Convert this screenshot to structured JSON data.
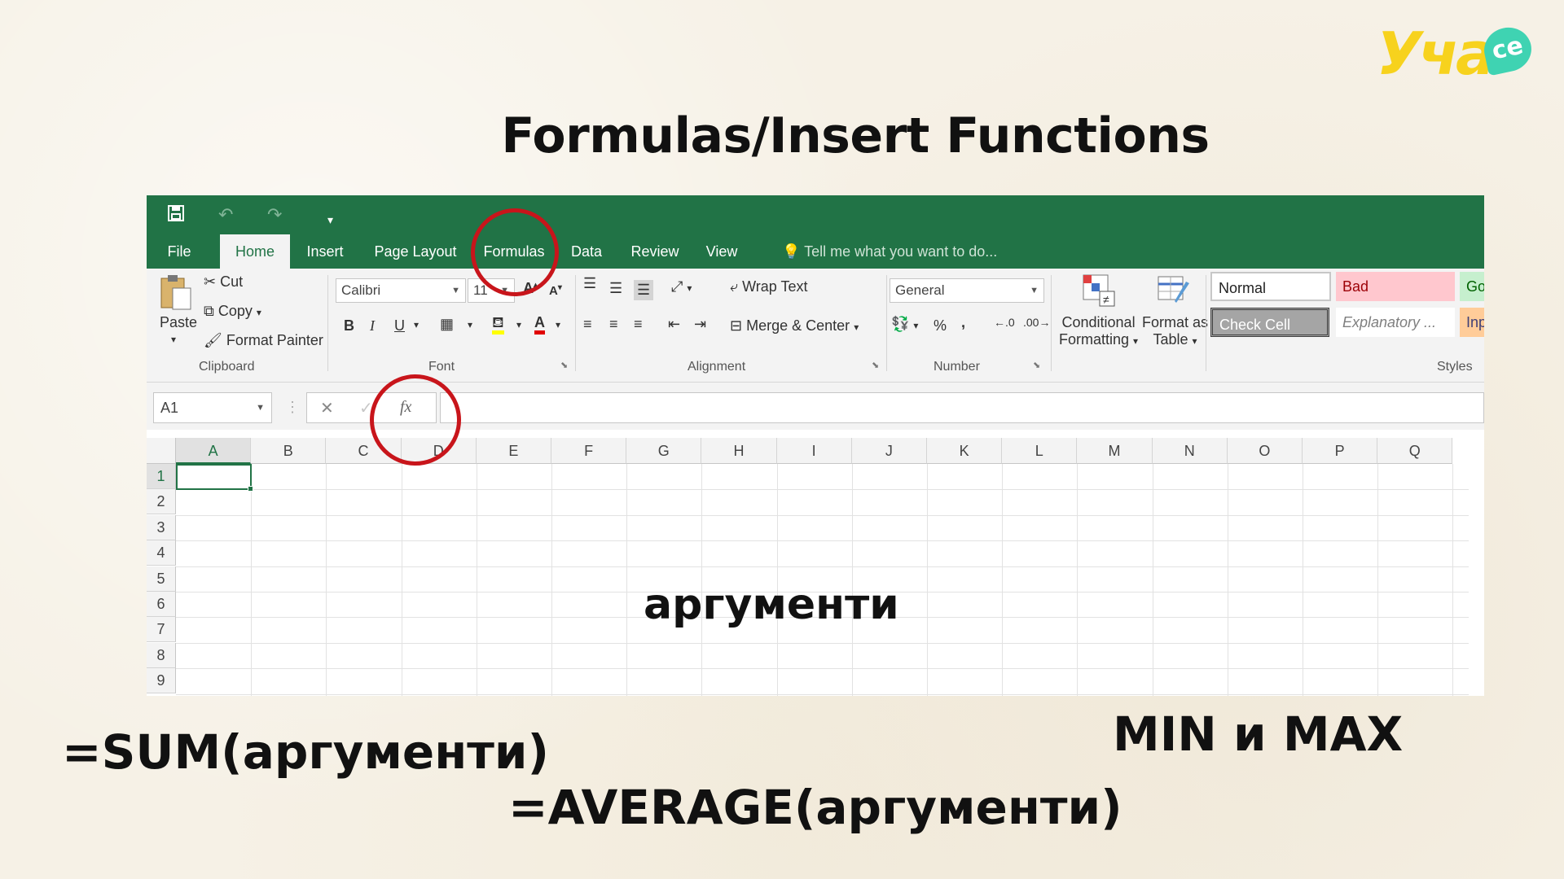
{
  "logo": {
    "text": "Уча",
    "badge": "се"
  },
  "slide": {
    "title": "Formulas/Insert Functions",
    "label_arguments": "аргументи",
    "label_sum": "=SUM(аргументи)",
    "label_average": "=AVERAGE(аргументи)",
    "label_minmax": "MIN и MAX"
  },
  "excel": {
    "tabs": {
      "file": "File",
      "home": "Home",
      "insert": "Insert",
      "page_layout": "Page Layout",
      "formulas": "Formulas",
      "data": "Data",
      "review": "Review",
      "view": "View",
      "tell_me": "Tell me what you want to do..."
    },
    "clipboard": {
      "paste": "Paste",
      "cut": "Cut",
      "copy": "Copy",
      "format_painter": "Format Painter",
      "label": "Clipboard"
    },
    "font": {
      "name": "Calibri",
      "size": "11",
      "label": "Font",
      "bold": "B",
      "italic": "I",
      "underline": "U"
    },
    "alignment": {
      "wrap_text": "Wrap Text",
      "merge_center": "Merge & Center",
      "label": "Alignment"
    },
    "number": {
      "format": "General",
      "label": "Number",
      "percent": "%",
      "comma": ","
    },
    "styles": {
      "conditional_formatting": "Conditional",
      "conditional_formatting_2": "Formatting",
      "format_as_table": "Format as",
      "format_as_table_2": "Table",
      "normal": "Normal",
      "bad": "Bad",
      "good": "Go",
      "check_cell": "Check Cell",
      "explanatory": "Explanatory ...",
      "input": "Inp",
      "label": "Styles"
    },
    "formula_bar": {
      "name_box": "A1",
      "fx": "fx",
      "cancel": "✕",
      "enter": "✓"
    },
    "columns": [
      "A",
      "B",
      "C",
      "D",
      "E",
      "F",
      "G",
      "H",
      "I",
      "J",
      "K",
      "L",
      "M",
      "N",
      "O",
      "P",
      "Q"
    ],
    "rows": [
      "1",
      "2",
      "3",
      "4",
      "5",
      "6",
      "7",
      "8",
      "9"
    ],
    "active_cell": "A1"
  },
  "colors": {
    "excel_green": "#217346",
    "annotation_red": "#c8151b",
    "logo_yellow": "#f7d21d",
    "logo_teal": "#3fd3b2"
  }
}
